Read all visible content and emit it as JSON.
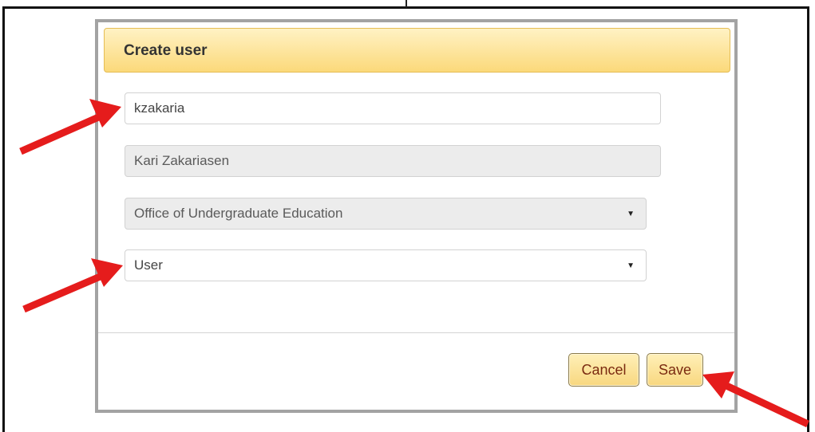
{
  "dialog": {
    "title": "Create user",
    "fields": {
      "username": {
        "value": "kzakaria"
      },
      "full_name": {
        "value": "Kari Zakariasen"
      },
      "department": {
        "value": "Office of Undergraduate Education"
      },
      "role": {
        "value": "User"
      }
    },
    "buttons": {
      "cancel_label": "Cancel",
      "save_label": "Save"
    }
  },
  "colors": {
    "header_gradient_top": "#fff2c4",
    "header_gradient_bottom": "#fbd97a",
    "button_text": "#7a2a10",
    "arrow": "#e51c1c"
  },
  "icons": {
    "dropdown": "caret-down-icon",
    "annotation": "red-arrow-icon"
  }
}
